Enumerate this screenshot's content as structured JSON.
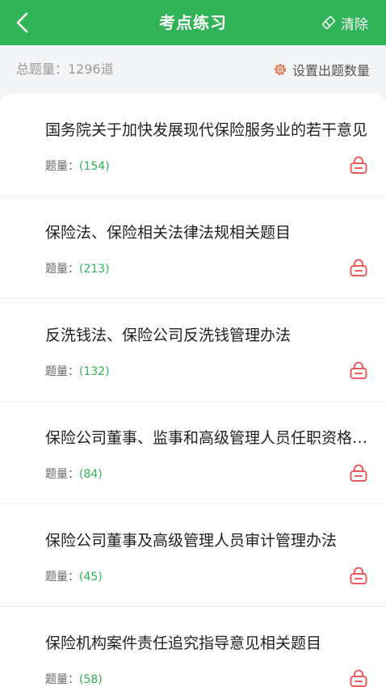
{
  "header": {
    "title": "考点练习",
    "clear_label": "清除"
  },
  "summary": {
    "total_label": "总题量：1296道",
    "setting_label": "设置出题数量"
  },
  "items": [
    {
      "title": "国务院关于加快发展现代保险服务业的若干意见",
      "count_label": "题量：",
      "count": "(154)"
    },
    {
      "title": "保险法、保险相关法律法规相关题目",
      "count_label": "题量：",
      "count": "(213)"
    },
    {
      "title": "反洗钱法、保险公司反洗钱管理办法",
      "count_label": "题量：",
      "count": "(132)"
    },
    {
      "title": "保险公司董事、监事和高级管理人员任职资格管理规定",
      "count_label": "题量：",
      "count": "(84)"
    },
    {
      "title": "保险公司董事及高级管理人员审计管理办法",
      "count_label": "题量：",
      "count": "(45)"
    },
    {
      "title": "保险机构案件责任追究指导意见相关题目",
      "count_label": "题量：",
      "count": "(58)"
    }
  ],
  "colors": {
    "brand_green": "#2fb356",
    "lock_red": "#ee5a5a"
  },
  "icons": {
    "back": "chevron-left-icon",
    "clear": "eraser-icon",
    "setting": "gear-icon",
    "lock": "lock-icon"
  }
}
